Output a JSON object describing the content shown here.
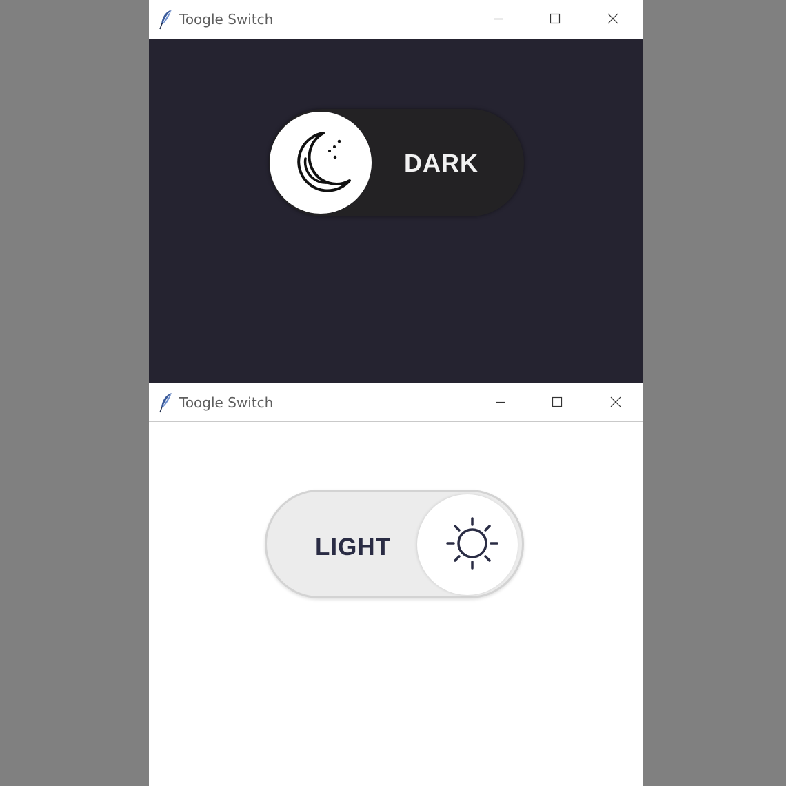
{
  "windows": [
    {
      "title": "Toogle Switch",
      "theme": "dark",
      "toggle": {
        "label": "DARK",
        "state": "dark",
        "knob_icon": "moon-icon"
      },
      "colors": {
        "background": "#252330",
        "track": "#232224",
        "knob": "#ffffff",
        "label": "#f2f2f2"
      }
    },
    {
      "title": "Toogle Switch",
      "theme": "light",
      "toggle": {
        "label": "LIGHT",
        "state": "light",
        "knob_icon": "sun-icon"
      },
      "colors": {
        "background": "#ffffff",
        "track": "#ececec",
        "knob": "#ffffff",
        "label": "#2a2c44"
      }
    }
  ],
  "window_controls": {
    "minimize_icon": "minimize-icon",
    "maximize_icon": "maximize-icon",
    "close_icon": "close-icon"
  },
  "colors": {
    "desktop": "#808080",
    "titlebar": "#ffffff",
    "title_text": "#5e5e5e"
  }
}
